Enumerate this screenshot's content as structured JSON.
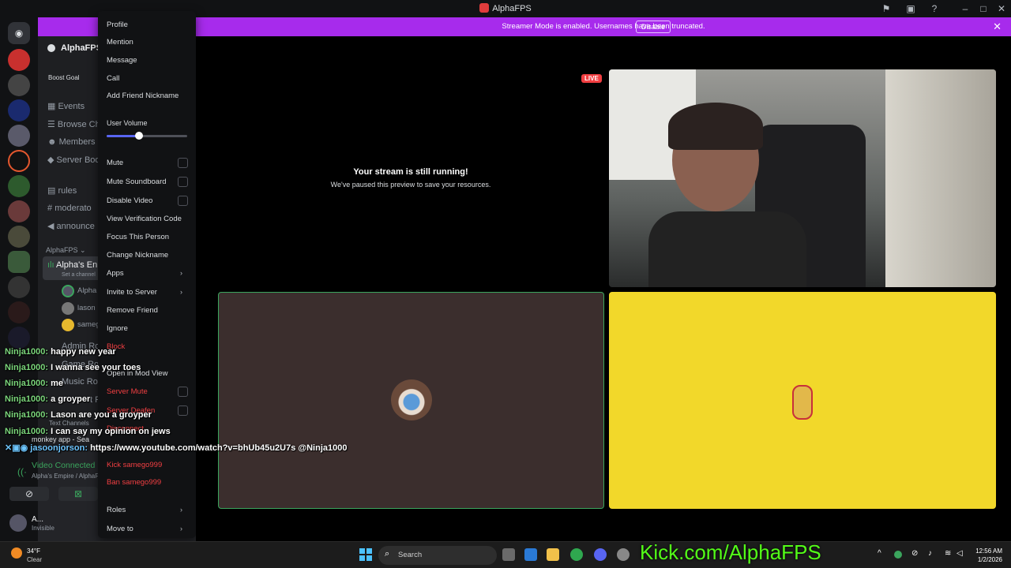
{
  "window": {
    "title": "AlphaFPS"
  },
  "banner": {
    "text": "Streamer Mode is enabled. Usernames have been truncated.",
    "button": "Disable"
  },
  "server": {
    "name": "AlphaFPS",
    "boost_label": "Boost Goal"
  },
  "sidebar": {
    "items": [
      {
        "label": "Events",
        "icon": "calendar-icon"
      },
      {
        "label": "Browse Ch",
        "icon": "browse-icon"
      },
      {
        "label": "Members",
        "icon": "members-icon"
      },
      {
        "label": "Server Boo",
        "icon": "boost-icon"
      }
    ],
    "channels": [
      "rules",
      "moderato",
      "announce"
    ],
    "category": "AlphaFPS",
    "voice_channel": "Alpha's En",
    "voice_sub": "Set a channel",
    "voice_users": [
      "Alpha",
      "lason",
      "samego"
    ],
    "lower_channels": [
      "Admin Ro",
      "Game Roo",
      "Music Roo",
      "t R"
    ],
    "text_channels_header": "Text Channels",
    "monkey": "monkey app - Sea",
    "connection": {
      "status": "Video Connected",
      "detail": "Alpha's Empire / AlphaF"
    },
    "user": {
      "name": "A...",
      "status": "Invisible"
    }
  },
  "menu": {
    "items_top": [
      "Profile",
      "Mention",
      "Message",
      "Call",
      "Add Friend Nickname"
    ],
    "volume_label": "User Volume",
    "volume_fraction": 0.4,
    "items_mid": [
      {
        "label": "Mute",
        "check": true
      },
      {
        "label": "Mute Soundboard",
        "check": true
      },
      {
        "label": "Disable Video",
        "check": true
      },
      {
        "label": "View Verification Code"
      },
      {
        "label": "Focus This Person"
      },
      {
        "label": "Change Nickname"
      },
      {
        "label": "Apps",
        "arrow": true
      },
      {
        "label": "Invite to Server",
        "arrow": true
      },
      {
        "label": "Remove Friend"
      },
      {
        "label": "Ignore"
      },
      {
        "label": "Block",
        "danger": true
      }
    ],
    "mod_view": "Open in Mod View",
    "server_mute": "Server Mute",
    "server_deafen": "Server Deafen",
    "disconnect": "Disconnect",
    "kick": "Kick samego999",
    "ban": "Ban samego999",
    "roles": "Roles",
    "move_to": "Move to"
  },
  "stage": {
    "live_badge": "LIVE",
    "paused_title": "Your stream is still running!",
    "paused_sub": "We've paused this preview to save your resources."
  },
  "chat": [
    {
      "user": "Ninja1000:",
      "msg": "happy new year"
    },
    {
      "user": "Ninja1000:",
      "msg": "I wanna see your toes"
    },
    {
      "user": "Ninja1000:",
      "msg": "me"
    },
    {
      "user": "Ninja1000:",
      "msg": "a groyper"
    },
    {
      "user": "Ninja1000:",
      "msg": "Lason are you a groyper"
    },
    {
      "user": "Ninja1000:",
      "msg": "I can say my opinion on jews"
    },
    {
      "user": "jasoonjorson:",
      "msg": "https://www.youtube.com/watch?v=bhUb45u2U7s @Ninja1000"
    }
  ],
  "taskbar": {
    "weather_temp": "34°F",
    "weather_desc": "Clear",
    "search": "Search",
    "overlay": "Kick.com/AlphaFPS",
    "time": "12:56 AM",
    "date": "1/2/2026"
  },
  "colors": {
    "banner": "#a72bec",
    "accent": "#5865f2",
    "danger": "#f23f42",
    "speaking": "#3ba55d",
    "tile_dark": "#3b2e2d",
    "tile_yellow": "#f2d82a"
  }
}
